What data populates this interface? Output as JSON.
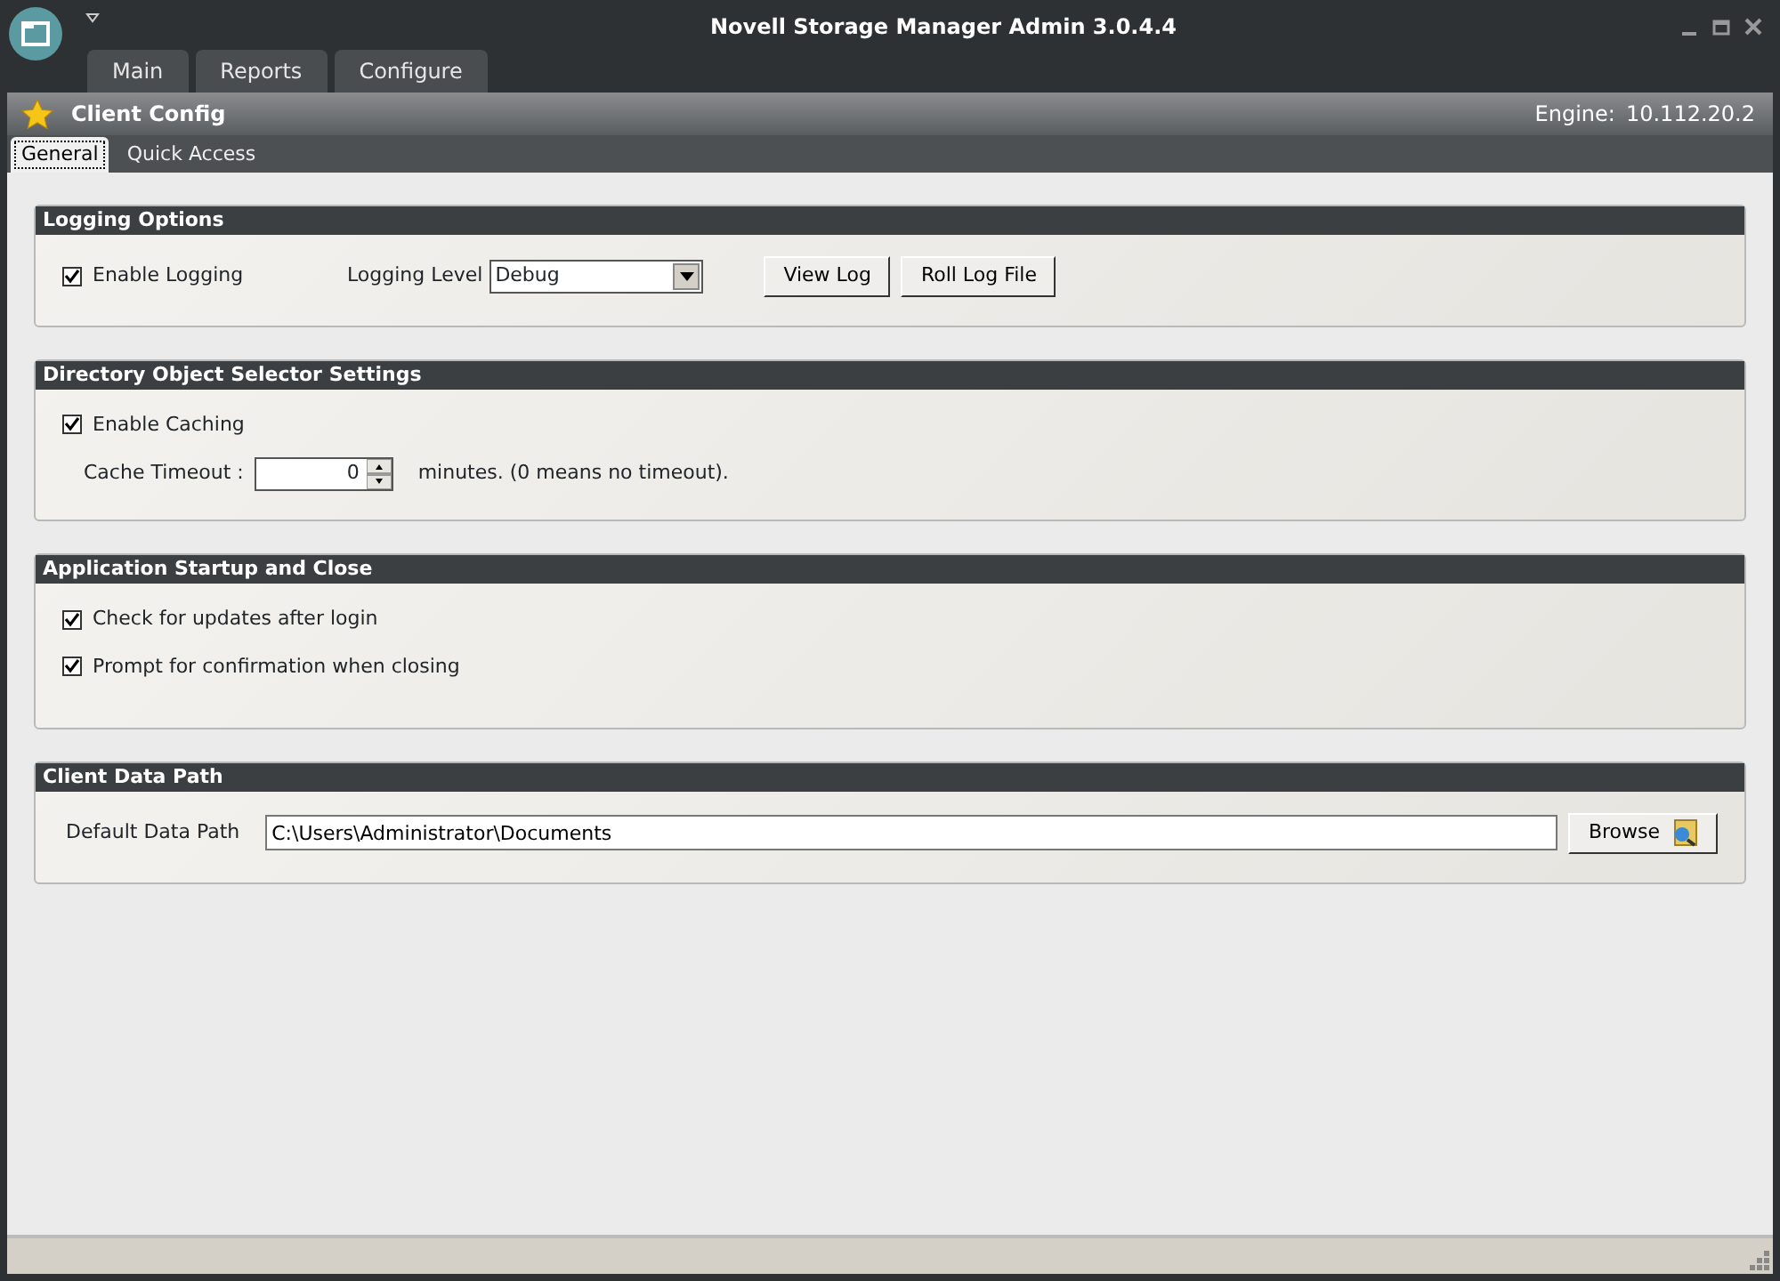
{
  "window": {
    "title": "Novell Storage Manager Admin 3.0.4.4"
  },
  "ribbon_tabs": [
    {
      "label": "Main",
      "selected": false
    },
    {
      "label": "Reports",
      "selected": false
    },
    {
      "label": "Configure",
      "selected": false
    }
  ],
  "header": {
    "title": "Client Config",
    "engine_label": "Engine:",
    "engine_value": "10.112.20.2"
  },
  "tabs": [
    {
      "label": "General",
      "selected": true
    },
    {
      "label": "Quick Access",
      "selected": false
    }
  ],
  "sections": [
    {
      "title": "Logging Options",
      "rows": [
        [
          {
            "kind": "checkbox",
            "label": "Enable Logging",
            "checked": true
          },
          {
            "kind": "label",
            "text": "Logging Level"
          },
          {
            "kind": "select",
            "value": "Debug"
          },
          {
            "kind": "button",
            "label": "View Log"
          },
          {
            "kind": "button",
            "label": "Roll Log File"
          }
        ]
      ]
    },
    {
      "title": "Directory Object Selector Settings",
      "rows": [
        [
          {
            "kind": "checkbox",
            "label": "Enable Caching",
            "checked": true
          }
        ],
        [
          {
            "kind": "label",
            "text": "Cache Timeout :"
          },
          {
            "kind": "spinner",
            "value": "0"
          },
          {
            "kind": "note",
            "text": "minutes. (0 means no timeout)."
          }
        ]
      ]
    },
    {
      "title": "Application Startup and Close",
      "rows": [
        [
          {
            "kind": "checkbox",
            "label": "Check for updates after login",
            "checked": true
          }
        ],
        [
          {
            "kind": "checkbox",
            "label": "Prompt for confirmation when closing",
            "checked": true
          }
        ]
      ]
    },
    {
      "title": "Client Data Path",
      "rows": [
        [
          {
            "kind": "label",
            "text": "Default Data Path"
          },
          {
            "kind": "textfield",
            "value": "C:\\Users\\Administrator\\Documents"
          },
          {
            "kind": "browse",
            "label": "Browse"
          }
        ]
      ]
    }
  ]
}
